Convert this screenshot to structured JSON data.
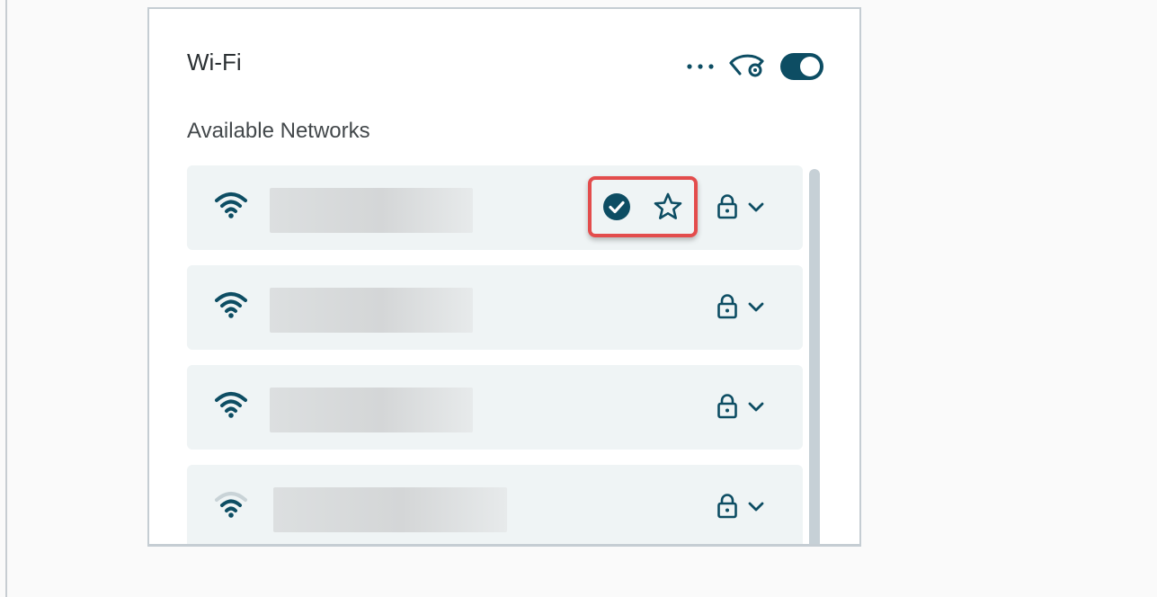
{
  "panel": {
    "title": "Wi-Fi",
    "section_label": "Available Networks",
    "wifi_enabled": true
  },
  "header": {
    "more_icon": "more-horizontal-icon",
    "visibility_settings_icon": "eye-settings-icon",
    "toggle_state": "on"
  },
  "networks": [
    {
      "signal_strength": "full",
      "secured": true,
      "connected": true,
      "favorite": false
    },
    {
      "signal_strength": "full",
      "secured": true,
      "connected": false,
      "favorite": false
    },
    {
      "signal_strength": "full",
      "secured": true,
      "connected": false,
      "favorite": false
    },
    {
      "signal_strength": "low",
      "secured": true,
      "connected": false,
      "favorite": false
    }
  ],
  "colors": {
    "accent": "#0d4d63",
    "item_background": "#eff4f5",
    "highlight": "#e34c4c",
    "scrollbar": "#c6d0d6"
  }
}
